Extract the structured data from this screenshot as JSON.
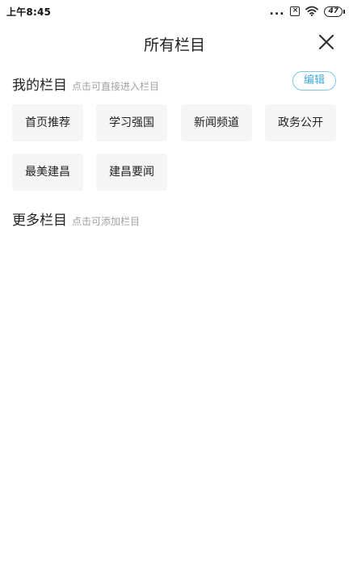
{
  "status_bar": {
    "time": "上午8:45",
    "dots": "...",
    "battery": "47",
    "icons": [
      "more-dots-icon",
      "sim-x-icon",
      "wifi-icon",
      "battery-icon"
    ]
  },
  "header": {
    "title": "所有栏目",
    "close_icon": "close-icon"
  },
  "my_columns": {
    "title": "我的栏目",
    "hint": "点击可直接进入栏目",
    "edit_label": "编辑",
    "items": [
      "首页推荐",
      "学习强国",
      "新闻频道",
      "政务公开",
      "最美建昌",
      "建昌要闻"
    ]
  },
  "more_columns": {
    "title": "更多栏目",
    "hint": "点击可添加栏目"
  },
  "colors": {
    "accent": "#45a9d9",
    "chip_bg": "#f5f5f5",
    "hint_text": "#a2a2a2"
  }
}
